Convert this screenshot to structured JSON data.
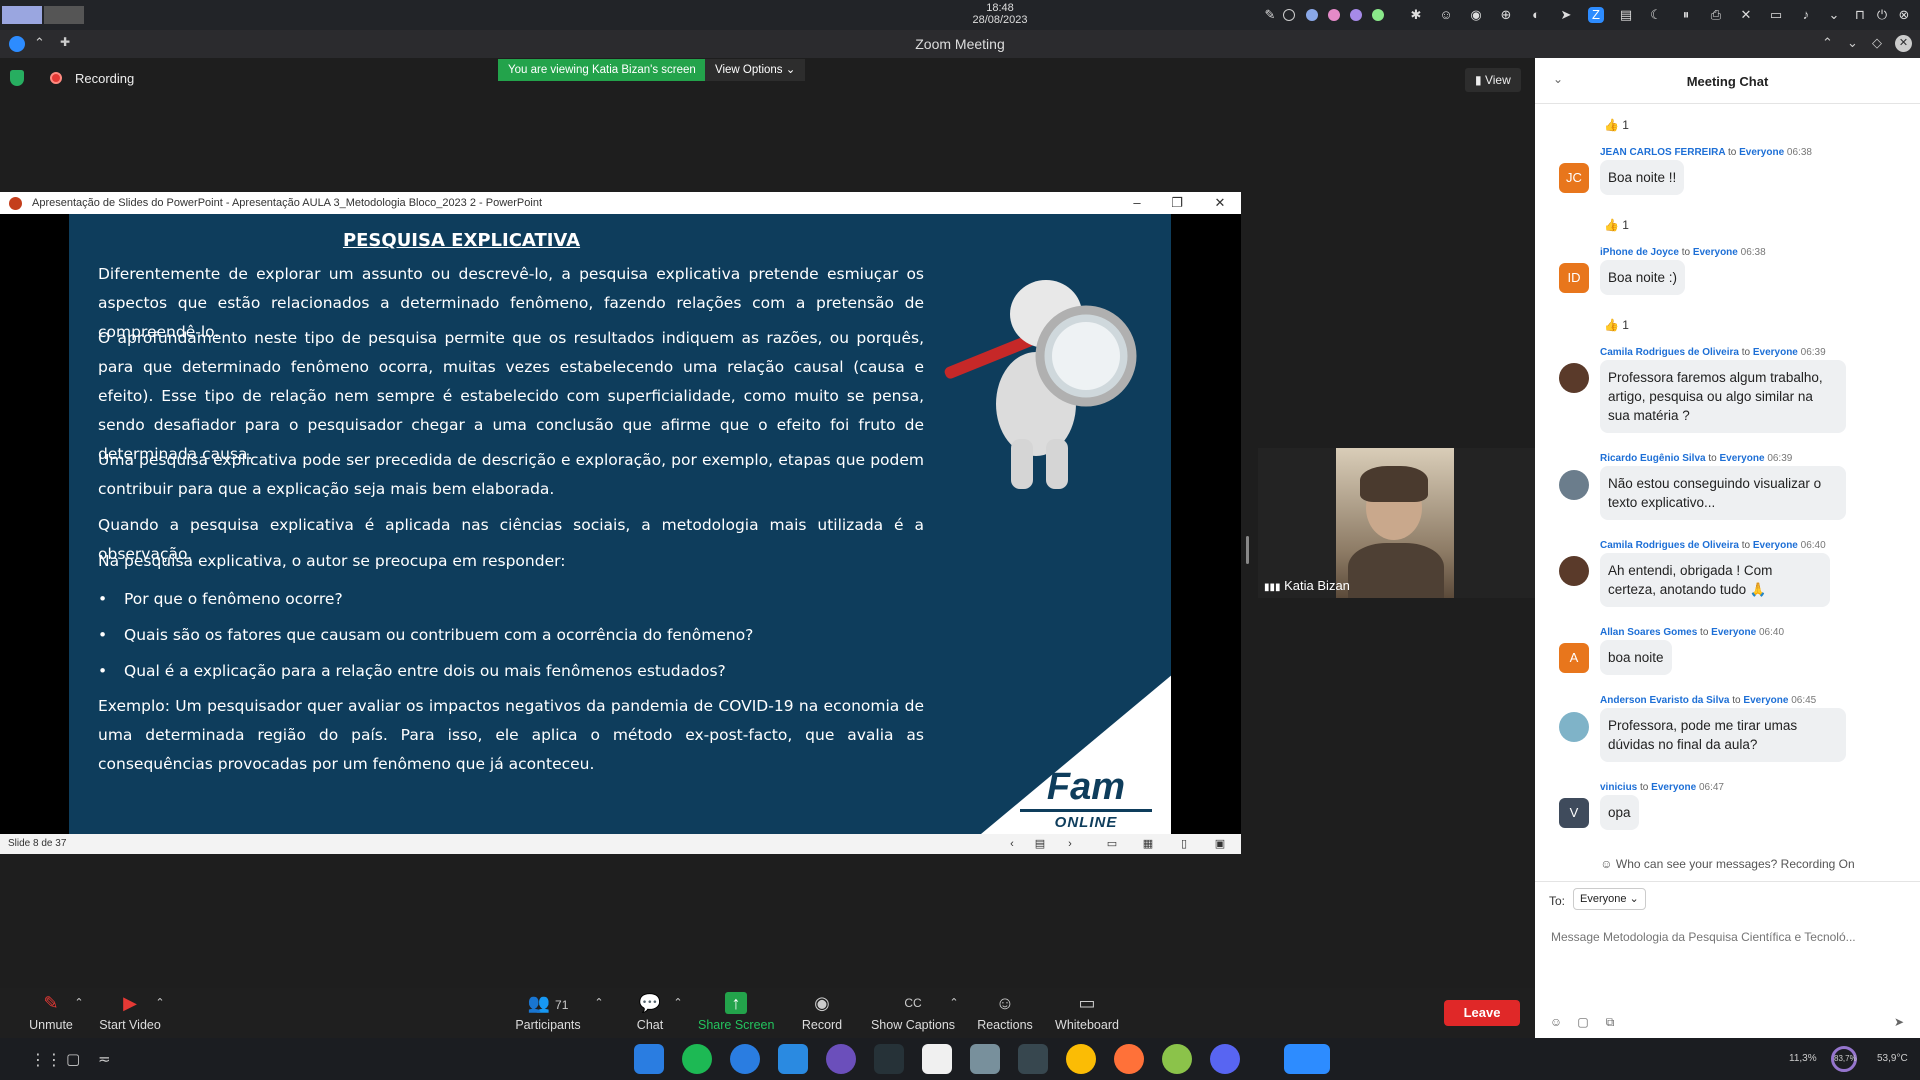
{
  "system": {
    "time": "18:48",
    "date": "28/08/2023"
  },
  "zoom": {
    "window_title": "Zoom Meeting",
    "recording_label": "Recording",
    "viewing_banner": "You are viewing Katia Bizan's screen",
    "view_options": "View Options",
    "view_button": "View"
  },
  "ppt": {
    "title": "Apresentação de Slides do PowerPoint  -  Apresentação AULA 3_Metodologia Bloco_2023 2 - PowerPoint",
    "status": "Slide 8 de 37",
    "slide": {
      "heading": "PESQUISA EXPLICATIVA",
      "p1": "Diferentemente de explorar um assunto ou descrevê-lo, a pesquisa explicativa pretende esmiuçar os aspectos que estão relacionados a determinado fenômeno, fazendo relações com a pretensão de compreendê-lo.",
      "p2": "O aprofundamento neste tipo de pesquisa permite que os resultados indiquem as razões, ou porquês, para que determinado fenômeno ocorra, muitas vezes estabelecendo uma relação causal (causa e efeito). Esse tipo de relação nem sempre é estabelecido com superficialidade, como muito se pensa, sendo desafiador para o pesquisador chegar a uma conclusão que afirme que o efeito foi fruto de determinada causa.",
      "p3": "Uma pesquisa explicativa pode ser precedida de descrição e exploração, por exemplo, etapas que podem contribuir para que a explicação seja mais bem elaborada.",
      "p4": "Quando a pesquisa explicativa é aplicada nas ciências sociais, a metodologia mais utilizada é a observação.",
      "p5": "Na pesquisa explicativa, o autor se preocupa em responder:",
      "bullets": [
        "Por que o fenômeno ocorre?",
        "Quais são os fatores que causam ou contribuem com a ocorrência do fenômeno?",
        "Qual é a explicação para a relação entre dois ou mais fenômenos estudados?"
      ],
      "p6": "Exemplo: Um pesquisador quer avaliar os impactos negativos da pandemia de COVID-19 na economia de uma determinada região do país. Para isso, ele aplica o método ex-post-facto, que avalia as consequências provocadas por um fenômeno que já aconteceu.",
      "logo_main": "Fam",
      "logo_sub": "ONLINE"
    }
  },
  "speaker": {
    "name": "Katia Bizan"
  },
  "chat": {
    "title": "Meeting Chat",
    "reaction_count": "1",
    "messages": [
      {
        "sender": "JEAN CARLOS FERREIRA",
        "to": "to",
        "audience": "Everyone",
        "time": "06:38",
        "initials": "JC",
        "text": "Boa noite !!"
      },
      {
        "sender": "iPhone de Joyce",
        "to": "to",
        "audience": "Everyone",
        "time": "06:38",
        "initials": "ID",
        "text": "Boa noite :)"
      },
      {
        "sender": "Camila Rodrigues de Oliveira",
        "to": "to",
        "audience": "Everyone",
        "time": "06:39",
        "initials": "",
        "text": "Professora faremos algum trabalho, artigo, pesquisa ou algo similar na sua matéria ?"
      },
      {
        "sender": "Ricardo Eugênio Silva",
        "to": "to",
        "audience": "Everyone",
        "time": "06:39",
        "initials": "",
        "text": "Não estou conseguindo visualizar o texto explicativo..."
      },
      {
        "sender": "Camila Rodrigues de Oliveira",
        "to": "to",
        "audience": "Everyone",
        "time": "06:40",
        "initials": "",
        "text": "Ah entendi, obrigada ! Com certeza, anotando tudo 🙏"
      },
      {
        "sender": "Allan Soares Gomes",
        "to": "to",
        "audience": "Everyone",
        "time": "06:40",
        "initials": "A",
        "text": "boa noite"
      },
      {
        "sender": "Anderson Evaristo da Silva",
        "to": "to",
        "audience": "Everyone",
        "time": "06:45",
        "initials": "",
        "text": "Professora, pode me tirar umas dúvidas no final da aula?"
      },
      {
        "sender": "vinicius",
        "to": "to",
        "audience": "Everyone",
        "time": "06:47",
        "initials": "V",
        "text": "opa"
      }
    ],
    "privacy": "Who can see your messages? Recording On",
    "to_label": "To:",
    "to_value": "Everyone",
    "placeholder": "Message Metodologia da Pesquisa Científica e Tecnoló..."
  },
  "toolbar": {
    "unmute": "Unmute",
    "start_video": "Start Video",
    "participants": "Participants",
    "participants_count": "71",
    "chat": "Chat",
    "share_screen": "Share Screen",
    "record": "Record",
    "show_captions": "Show Captions",
    "reactions": "Reactions",
    "whiteboard": "Whiteboard",
    "leave": "Leave"
  },
  "taskbar": {
    "cpu": "11,3%",
    "mem": "83,7%",
    "temp": "53,9°C"
  }
}
